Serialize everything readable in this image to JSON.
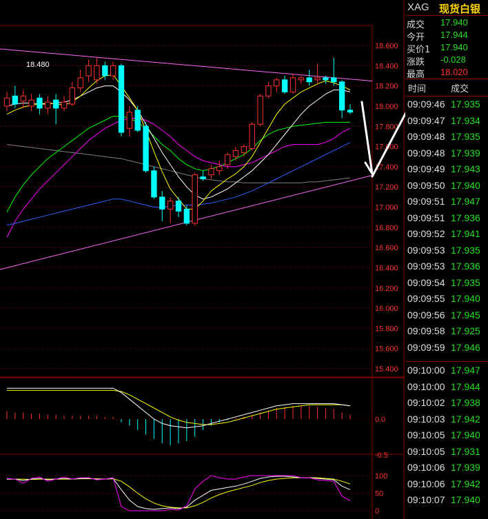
{
  "header": {
    "symbol": "XAG",
    "name": "现货白银"
  },
  "quote": [
    {
      "label": "成交",
      "value": "17.940",
      "color": "#22e022"
    },
    {
      "label": "今开",
      "value": "17.944",
      "color": "#22e022"
    },
    {
      "label": "买价1",
      "value": "17.940",
      "color": "#22e022"
    },
    {
      "label": "涨跌",
      "value": "-0.028",
      "color": "#22e022"
    },
    {
      "label": "最高",
      "value": "18.020",
      "color": "#ff3030"
    }
  ],
  "ticks_header": {
    "time": "时间",
    "price": "成交"
  },
  "ticks_group1": [
    {
      "time": "09:09:46",
      "price": "17.935"
    },
    {
      "time": "09:09:47",
      "price": "17.934"
    },
    {
      "time": "09:09:48",
      "price": "17.935"
    },
    {
      "time": "09:09:48",
      "price": "17.939"
    },
    {
      "time": "09:09:49",
      "price": "17.943"
    },
    {
      "time": "09:09:50",
      "price": "17.940"
    },
    {
      "time": "09:09:51",
      "price": "17.947"
    },
    {
      "time": "09:09:51",
      "price": "17.936"
    },
    {
      "time": "09:09:52",
      "price": "17.941"
    },
    {
      "time": "09:09:53",
      "price": "17.935"
    },
    {
      "time": "09:09:53",
      "price": "17.936"
    },
    {
      "time": "09:09:54",
      "price": "17.935"
    },
    {
      "time": "09:09:55",
      "price": "17.940"
    },
    {
      "time": "09:09:56",
      "price": "17.945"
    },
    {
      "time": "09:09:58",
      "price": "17.925"
    },
    {
      "time": "09:09:59",
      "price": "17.946"
    }
  ],
  "ticks_group2": [
    {
      "time": "09:10:00",
      "price": "17.947"
    },
    {
      "time": "09:10:00",
      "price": "17.944"
    },
    {
      "time": "09:10:02",
      "price": "17.938"
    },
    {
      "time": "09:10:03",
      "price": "17.942"
    },
    {
      "time": "09:10:05",
      "price": "17.940"
    },
    {
      "time": "09:10:05",
      "price": "17.931"
    },
    {
      "time": "09:10:06",
      "price": "17.939"
    },
    {
      "time": "09:10:06",
      "price": "17.942"
    },
    {
      "time": "09:10:07",
      "price": "17.940"
    }
  ],
  "chart_data": {
    "type": "candlestick",
    "colors": {
      "up": "#ff3030",
      "down": "#00ffff",
      "grid": "#8b0000",
      "axis_text": "#ff3030"
    },
    "price_axis": {
      "min": 15.4,
      "max": 18.6,
      "ticks": [
        "18.600",
        "18.400",
        "18.200",
        "18.000",
        "17.800",
        "17.600",
        "17.400",
        "17.200",
        "17.000",
        "16.800",
        "16.600",
        "16.400",
        "16.200",
        "16.000",
        "15.800",
        "15.600",
        "15.400"
      ]
    },
    "max_annotation": "18.480",
    "candles": [
      {
        "o": 18.0,
        "c": 18.08,
        "h": 18.14,
        "l": 17.95
      },
      {
        "o": 18.1,
        "c": 18.02,
        "h": 18.2,
        "l": 17.98
      },
      {
        "o": 18.05,
        "c": 18.1,
        "h": 18.16,
        "l": 17.98
      },
      {
        "o": 18.0,
        "c": 18.06,
        "h": 18.12,
        "l": 17.95
      },
      {
        "o": 18.08,
        "c": 17.98,
        "h": 18.12,
        "l": 17.92
      },
      {
        "o": 17.98,
        "c": 18.04,
        "h": 18.1,
        "l": 17.92
      },
      {
        "o": 18.06,
        "c": 17.98,
        "h": 18.12,
        "l": 17.82
      },
      {
        "o": 17.98,
        "c": 18.04,
        "h": 18.1,
        "l": 17.95
      },
      {
        "o": 18.02,
        "c": 18.18,
        "h": 18.24,
        "l": 18.0
      },
      {
        "o": 18.18,
        "c": 18.28,
        "h": 18.36,
        "l": 18.14
      },
      {
        "o": 18.3,
        "c": 18.4,
        "h": 18.46,
        "l": 18.24
      },
      {
        "o": 18.26,
        "c": 18.4,
        "h": 18.48,
        "l": 18.22
      },
      {
        "o": 18.4,
        "c": 18.3,
        "h": 18.44,
        "l": 18.26
      },
      {
        "o": 18.3,
        "c": 18.4,
        "h": 18.44,
        "l": 18.26
      },
      {
        "o": 18.4,
        "c": 17.74,
        "h": 18.42,
        "l": 17.7
      },
      {
        "o": 17.78,
        "c": 17.94,
        "h": 18.0,
        "l": 17.7
      },
      {
        "o": 17.96,
        "c": 17.76,
        "h": 18.0,
        "l": 17.74
      },
      {
        "o": 17.8,
        "c": 17.36,
        "h": 17.84,
        "l": 17.34
      },
      {
        "o": 17.36,
        "c": 17.1,
        "h": 17.4,
        "l": 17.08
      },
      {
        "o": 17.1,
        "c": 16.98,
        "h": 17.16,
        "l": 16.86
      },
      {
        "o": 16.98,
        "c": 17.06,
        "h": 17.1,
        "l": 16.84
      },
      {
        "o": 17.06,
        "c": 16.96,
        "h": 17.1,
        "l": 16.9
      },
      {
        "o": 16.98,
        "c": 16.84,
        "h": 17.02,
        "l": 16.82
      },
      {
        "o": 16.84,
        "c": 17.32,
        "h": 17.34,
        "l": 16.82
      },
      {
        "o": 17.3,
        "c": 17.28,
        "h": 17.36,
        "l": 17.26
      },
      {
        "o": 17.32,
        "c": 17.38,
        "h": 17.42,
        "l": 17.28
      },
      {
        "o": 17.36,
        "c": 17.4,
        "h": 17.46,
        "l": 17.32
      },
      {
        "o": 17.42,
        "c": 17.52,
        "h": 17.54,
        "l": 17.38
      },
      {
        "o": 17.5,
        "c": 17.56,
        "h": 17.6,
        "l": 17.46
      },
      {
        "o": 17.54,
        "c": 17.6,
        "h": 17.62,
        "l": 17.5
      },
      {
        "o": 17.58,
        "c": 17.82,
        "h": 17.84,
        "l": 17.56
      },
      {
        "o": 17.82,
        "c": 18.1,
        "h": 18.12,
        "l": 17.8
      },
      {
        "o": 18.1,
        "c": 18.2,
        "h": 18.24,
        "l": 18.08
      },
      {
        "o": 18.2,
        "c": 18.26,
        "h": 18.28,
        "l": 18.14
      },
      {
        "o": 18.26,
        "c": 18.14,
        "h": 18.3,
        "l": 18.12
      },
      {
        "o": 18.14,
        "c": 18.28,
        "h": 18.32,
        "l": 18.12
      },
      {
        "o": 18.26,
        "c": 18.28,
        "h": 18.3,
        "l": 18.22
      },
      {
        "o": 18.28,
        "c": 18.24,
        "h": 18.36,
        "l": 18.2
      },
      {
        "o": 18.26,
        "c": 18.28,
        "h": 18.42,
        "l": 18.22
      },
      {
        "o": 18.28,
        "c": 18.26,
        "h": 18.3,
        "l": 18.22
      },
      {
        "o": 18.28,
        "c": 18.24,
        "h": 18.48,
        "l": 18.2
      },
      {
        "o": 18.24,
        "c": 17.96,
        "h": 18.26,
        "l": 17.88
      },
      {
        "o": 17.96,
        "c": 17.94,
        "h": 18.02,
        "l": 17.92
      }
    ],
    "ma_yellow": [
      17.92,
      17.96,
      17.99,
      18.01,
      18.02,
      18.03,
      18.02,
      18.01,
      18.04,
      18.1,
      18.18,
      18.25,
      18.3,
      18.31,
      18.2,
      18.08,
      17.96,
      17.76,
      17.55,
      17.35,
      17.18,
      17.08,
      16.98,
      16.98,
      17.06,
      17.16,
      17.22,
      17.28,
      17.33,
      17.4,
      17.5,
      17.64,
      17.78,
      17.92,
      18.02,
      18.08,
      18.14,
      18.18,
      18.22,
      18.25,
      18.23,
      18.2,
      18.16
    ],
    "ma_white": [
      18.0,
      18.02,
      18.03,
      18.03,
      18.02,
      18.02,
      18.03,
      18.04,
      18.06,
      18.1,
      18.14,
      18.18,
      18.2,
      18.2,
      18.14,
      18.06,
      17.96,
      17.82,
      17.68,
      17.54,
      17.42,
      17.3,
      17.2,
      17.12,
      17.08,
      17.1,
      17.14,
      17.18,
      17.24,
      17.3,
      17.36,
      17.44,
      17.52,
      17.62,
      17.72,
      17.82,
      17.92,
      18.0,
      18.06,
      18.12,
      18.16,
      18.16,
      18.14
    ],
    "ma_green": [
      16.95,
      17.1,
      17.22,
      17.32,
      17.4,
      17.48,
      17.54,
      17.6,
      17.66,
      17.72,
      17.78,
      17.82,
      17.86,
      17.9,
      17.9,
      17.88,
      17.84,
      17.78,
      17.7,
      17.62,
      17.56,
      17.48,
      17.42,
      17.38,
      17.36,
      17.38,
      17.4,
      17.44,
      17.48,
      17.52,
      17.58,
      17.66,
      17.72,
      17.76,
      17.78,
      17.8,
      17.81,
      17.82,
      17.83,
      17.84,
      17.84,
      17.84,
      17.84
    ],
    "ma_magenta": [
      16.7,
      16.86,
      16.98,
      17.08,
      17.18,
      17.26,
      17.34,
      17.42,
      17.5,
      17.58,
      17.66,
      17.72,
      17.78,
      17.82,
      17.86,
      17.88,
      17.88,
      17.86,
      17.82,
      17.76,
      17.7,
      17.62,
      17.56,
      17.5,
      17.46,
      17.44,
      17.42,
      17.4,
      17.4,
      17.42,
      17.44,
      17.48,
      17.52,
      17.56,
      17.6,
      17.62,
      17.62,
      17.62,
      17.62,
      17.64,
      17.68,
      17.74,
      17.78
    ],
    "ma_gray": [
      17.62,
      17.61,
      17.6,
      17.59,
      17.58,
      17.57,
      17.56,
      17.55,
      17.54,
      17.53,
      17.52,
      17.51,
      17.5,
      17.49,
      17.48,
      17.46,
      17.44,
      17.42,
      17.4,
      17.38,
      17.36,
      17.34,
      17.32,
      17.3,
      17.28,
      17.27,
      17.26,
      17.25,
      17.25,
      17.24,
      17.24,
      17.24,
      17.24,
      17.24,
      17.24,
      17.24,
      17.24,
      17.25,
      17.25,
      17.26,
      17.27,
      17.28,
      17.29
    ],
    "ma_blue": [
      16.82,
      16.84,
      16.86,
      16.88,
      16.9,
      16.92,
      16.94,
      16.96,
      16.98,
      17.0,
      17.02,
      17.04,
      17.06,
      17.08,
      17.08,
      17.06,
      17.04,
      17.02,
      17.0,
      17.0,
      17.01,
      17.02,
      17.02,
      17.02,
      17.03,
      17.04,
      17.06,
      17.08,
      17.1,
      17.13,
      17.16,
      17.2,
      17.24,
      17.28,
      17.32,
      17.36,
      17.4,
      17.44,
      17.48,
      17.52,
      17.56,
      17.6,
      17.64
    ],
    "macd": {
      "axis_ticks": [
        "0.0",
        "-0.5"
      ],
      "hist": [
        0.07,
        0.06,
        0.06,
        0.05,
        0.05,
        0.04,
        0.04,
        0.03,
        0.03,
        0.03,
        0.03,
        0.03,
        0.02,
        0.02,
        -0.03,
        -0.06,
        -0.1,
        -0.14,
        -0.18,
        -0.22,
        -0.24,
        -0.22,
        -0.2,
        -0.16,
        -0.1,
        -0.06,
        -0.03,
        -0.01,
        0.01,
        0.02,
        0.04,
        0.06,
        0.08,
        0.1,
        0.11,
        0.12,
        0.12,
        0.12,
        0.11,
        0.1,
        0.09,
        0.06,
        0.04
      ],
      "dif": [
        0.28,
        0.28,
        0.28,
        0.28,
        0.28,
        0.28,
        0.28,
        0.28,
        0.28,
        0.28,
        0.28,
        0.28,
        0.28,
        0.28,
        0.24,
        0.18,
        0.12,
        0.06,
        0.0,
        -0.04,
        -0.06,
        -0.07,
        -0.08,
        -0.07,
        -0.06,
        -0.04,
        -0.02,
        0.0,
        0.02,
        0.04,
        0.06,
        0.08,
        0.1,
        0.12,
        0.13,
        0.14,
        0.14,
        0.14,
        0.14,
        0.14,
        0.14,
        0.13,
        0.12
      ],
      "dea": [
        0.26,
        0.26,
        0.26,
        0.26,
        0.26,
        0.26,
        0.26,
        0.26,
        0.26,
        0.26,
        0.26,
        0.26,
        0.26,
        0.26,
        0.25,
        0.22,
        0.18,
        0.14,
        0.1,
        0.06,
        0.02,
        -0.01,
        -0.03,
        -0.04,
        -0.05,
        -0.05,
        -0.04,
        -0.03,
        -0.01,
        0.01,
        0.03,
        0.05,
        0.07,
        0.09,
        0.1,
        0.11,
        0.12,
        0.13,
        0.13,
        0.13,
        0.13,
        0.13,
        0.12
      ]
    },
    "kdj": {
      "axis_ticks": [
        "100",
        "50",
        "0"
      ],
      "k": [
        90,
        90,
        86,
        90,
        92,
        88,
        90,
        92,
        90,
        92,
        92,
        90,
        90,
        92,
        60,
        30,
        12,
        6,
        4,
        6,
        8,
        6,
        10,
        30,
        44,
        58,
        62,
        66,
        70,
        76,
        84,
        92,
        96,
        98,
        98,
        96,
        94,
        94,
        92,
        90,
        88,
        70,
        60
      ],
      "d": [
        90,
        90,
        90,
        89,
        90,
        90,
        90,
        90,
        90,
        91,
        91,
        91,
        90,
        91,
        84,
        68,
        50,
        34,
        22,
        14,
        10,
        8,
        8,
        14,
        24,
        36,
        46,
        54,
        60,
        66,
        72,
        80,
        86,
        90,
        92,
        94,
        94,
        94,
        94,
        92,
        90,
        84,
        76
      ],
      "j": [
        92,
        90,
        78,
        92,
        96,
        84,
        90,
        96,
        90,
        94,
        94,
        88,
        90,
        94,
        12,
        0,
        0,
        0,
        0,
        0,
        4,
        2,
        14,
        62,
        84,
        100,
        94,
        90,
        90,
        96,
        100,
        100,
        100,
        100,
        100,
        100,
        94,
        94,
        88,
        86,
        84,
        42,
        28
      ]
    },
    "trendlines": [
      {
        "from": [
          0,
          18.56
        ],
        "to": [
          43,
          18.26
        ],
        "color": "#ff66ff"
      },
      {
        "from": [
          0,
          16.4
        ],
        "to": [
          43,
          17.28
        ],
        "color": "#ff66ff"
      }
    ]
  }
}
